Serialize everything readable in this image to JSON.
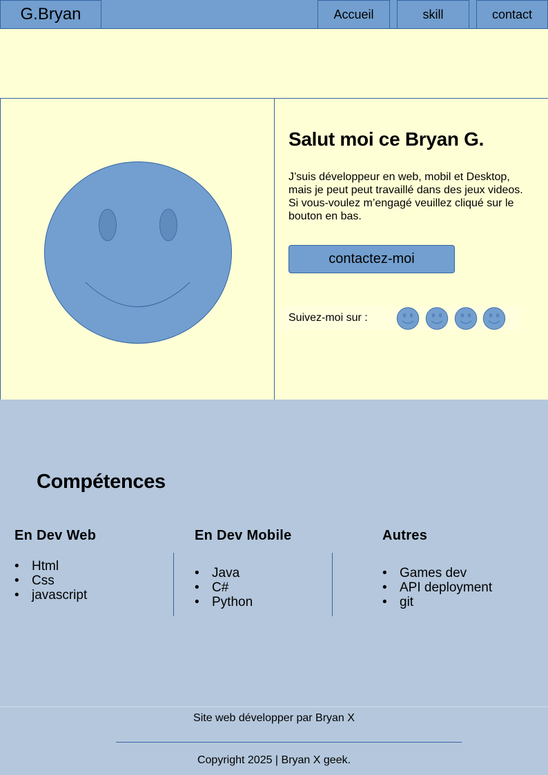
{
  "nav": {
    "logo": "G.Bryan",
    "links": [
      "Accueil",
      "skill",
      "contact"
    ]
  },
  "hero": {
    "title": "Salut moi ce Bryan G.",
    "text": "J’suis développeur en web, mobil et Desktop, mais je peut peut travaillé dans des jeux videos. Si vous-voulez m’engagé veuillez cliqué sur le bouton en bas.",
    "button": "contactez-moi",
    "follow_label": "Suivez-moi sur :",
    "avatar_icon": "smiley-face-icon",
    "social_icons": [
      "smiley-icon",
      "smiley-icon",
      "smiley-icon",
      "smiley-icon"
    ]
  },
  "skills": {
    "title": "Compétences",
    "columns": [
      {
        "title": "En Dev Web",
        "items": [
          "Html",
          "Css",
          "javascript"
        ]
      },
      {
        "title": "En Dev Mobile",
        "items": [
          "Java",
          "C#",
          "Python"
        ]
      },
      {
        "title": "Autres",
        "items": [
          "Games dev",
          "API deployment",
          "git"
        ]
      }
    ]
  },
  "footer": {
    "made_by": "Site web développer par Bryan X",
    "copyright": "Copyright 2025 | Bryan X geek."
  },
  "colors": {
    "nav": "#729fcf",
    "border": "#3465a4",
    "hero_bg": "#ffffd6",
    "skills_bg": "#b4c7dc",
    "face_fill": "#729fcf",
    "eye_fill": "#5f8bbd"
  }
}
